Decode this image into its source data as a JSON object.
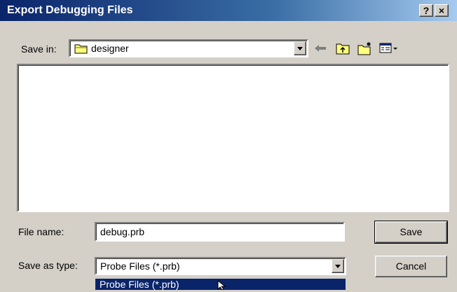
{
  "window": {
    "title": "Export Debugging Files",
    "help_label": "?",
    "close_label": "×"
  },
  "save_in": {
    "label": "Save in:",
    "value": "designer"
  },
  "toolbar": {
    "icons": [
      "back-arrow-icon",
      "up-folder-icon",
      "new-folder-icon",
      "view-menu-icon"
    ]
  },
  "file_name": {
    "label": "File name:",
    "value": "debug.prb"
  },
  "save_as_type": {
    "label": "Save as type:",
    "value": "Probe Files (*.prb)",
    "options": [
      "Probe Files (*.prb)"
    ]
  },
  "buttons": {
    "save": "Save",
    "cancel": "Cancel"
  },
  "colors": {
    "title_bar": "#0a246a",
    "face": "#d4d0c8",
    "selection": "#0a246a"
  }
}
